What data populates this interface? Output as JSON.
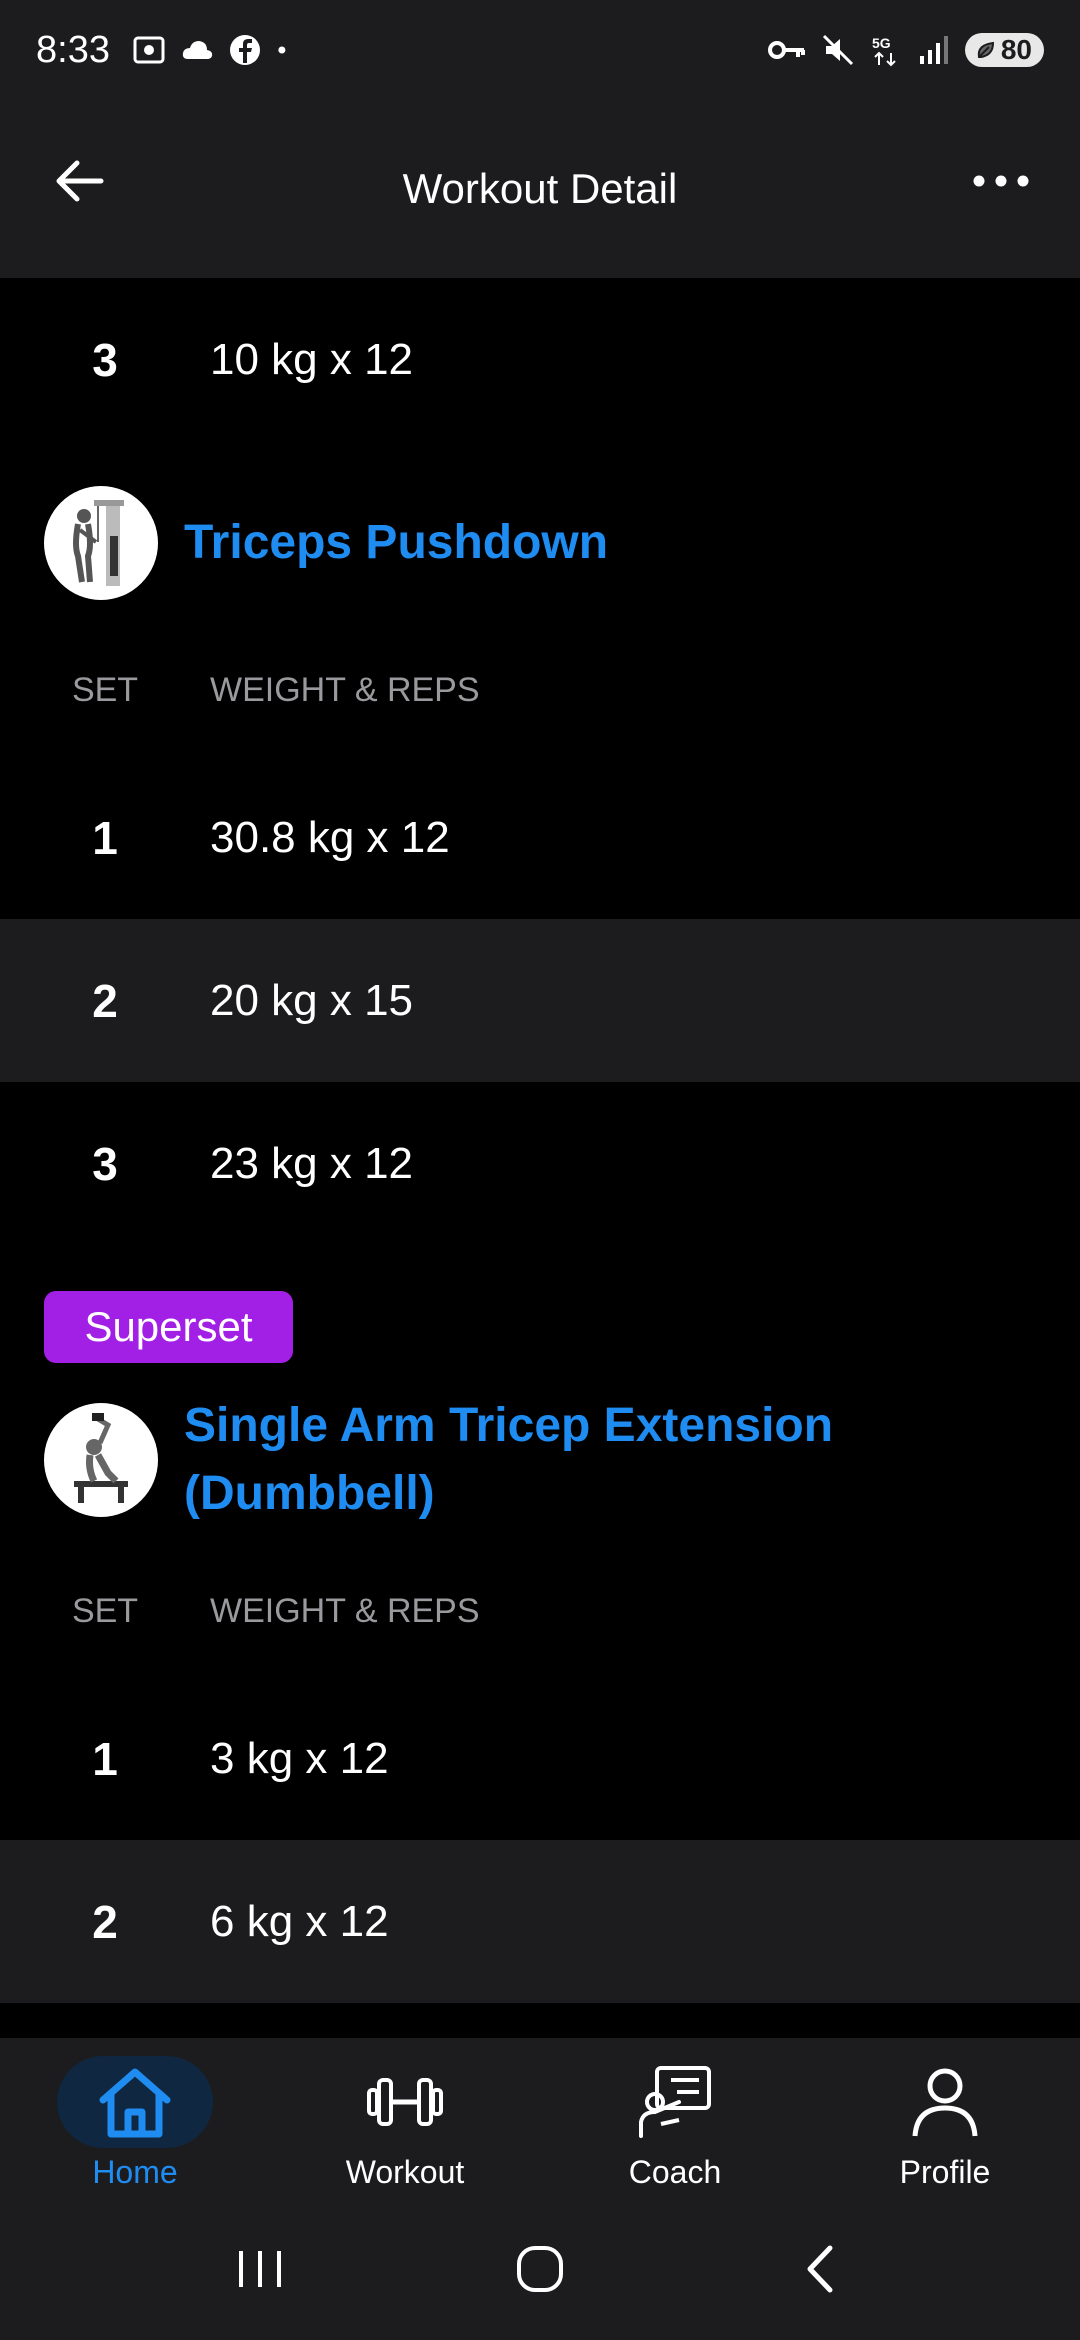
{
  "status_bar": {
    "time": "8:33",
    "left_icons": [
      "screenshot-icon",
      "cloud-icon",
      "facebook-icon",
      "dot-icon"
    ],
    "right_icons": [
      "vpn-key-icon",
      "mute-icon",
      "5g-icon",
      "signal-icon"
    ],
    "network": "5G",
    "battery": "80"
  },
  "header": {
    "title": "Workout Detail",
    "back_icon": "back-arrow-icon",
    "more_icon": "more-dots-icon"
  },
  "colors": {
    "accent": "#1f8cf2",
    "superset": "#a21fe6",
    "surface": "#1c1c1e",
    "background": "#000000"
  },
  "prev_exercise_tail": {
    "sets": [
      {
        "set": "3",
        "value": "10 kg x 12"
      }
    ]
  },
  "exercises": [
    {
      "name": "Triceps Pushdown",
      "superset": false,
      "columns": {
        "set": "SET",
        "weight_reps": "WEIGHT & REPS"
      },
      "sets": [
        {
          "set": "1",
          "value": "30.8 kg x 12"
        },
        {
          "set": "2",
          "value": "20 kg x 15"
        },
        {
          "set": "3",
          "value": "23 kg x 12"
        }
      ]
    },
    {
      "badge": "Superset",
      "name_line1": "Single Arm Tricep Extension",
      "name_line2": "(Dumbbell)",
      "superset": true,
      "columns": {
        "set": "SET",
        "weight_reps": "WEIGHT & REPS"
      },
      "sets": [
        {
          "set": "1",
          "value": "3 kg x 12"
        },
        {
          "set": "2",
          "value": "6 kg x 12"
        }
      ]
    }
  ],
  "tabs": [
    {
      "label": "Home",
      "icon": "home-icon",
      "active": true
    },
    {
      "label": "Workout",
      "icon": "dumbbell-icon",
      "active": false
    },
    {
      "label": "Coach",
      "icon": "coach-icon",
      "active": false
    },
    {
      "label": "Profile",
      "icon": "profile-icon",
      "active": false
    }
  ],
  "system_nav": [
    "recents-icon",
    "home-circle-icon",
    "back-chevron-icon"
  ]
}
